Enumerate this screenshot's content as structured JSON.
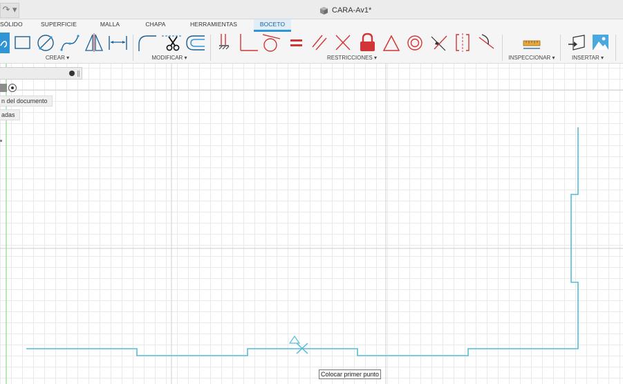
{
  "window": {
    "title": "CARA-Av1*",
    "quick_access_glyph": "↷ ▾",
    "doc_icon": "box-icon"
  },
  "tabs": [
    {
      "label": "SÓLIDO",
      "active": false
    },
    {
      "label": "SUPERFICIE",
      "active": false
    },
    {
      "label": "MALLA",
      "active": false
    },
    {
      "label": "CHAPA",
      "active": false
    },
    {
      "label": "HERRAMIENTAS",
      "active": false
    },
    {
      "label": "BOCETO",
      "active": true
    }
  ],
  "toolbar": {
    "groups": [
      {
        "label": "CREAR ▾",
        "tools": [
          "spline-icon",
          "rectangle-icon",
          "circle-icon",
          "fit-point-spline-icon",
          "triangle-mirror-icon",
          "dimension-icon"
        ]
      },
      {
        "label": "MODIFICAR ▾",
        "tools": [
          "fillet-icon",
          "trim-icon",
          "offset-icon"
        ]
      },
      {
        "label": "RESTRICCIONES ▾",
        "tools": [
          "horizontal-vertical-icon",
          "perpendicular-icon",
          "tangent-icon",
          "equal-icon",
          "parallel-icon",
          "coincident-icon",
          "fix-icon",
          "triangle-icon",
          "concentric-icon",
          "midpoint-icon",
          "symmetry-icon",
          "smooth-icon"
        ]
      },
      {
        "label": "INSPECCIONAR ▾",
        "tools": [
          "measure-icon"
        ]
      },
      {
        "label": "INSERTAR ▾",
        "tools": [
          "insert-derive-icon",
          "insert-image-icon"
        ]
      }
    ]
  },
  "browser": {
    "items": [
      {
        "label": "n del documento"
      },
      {
        "label": "adas"
      }
    ]
  },
  "canvas": {
    "tooltip": "Colocar primer punto",
    "colors": {
      "sketch_line": "#54bcd8",
      "grid": "#eaeaea",
      "axis_green": "#9fe09f",
      "active_tab": "#2f95d6",
      "constraint_red": "#d23535"
    }
  }
}
